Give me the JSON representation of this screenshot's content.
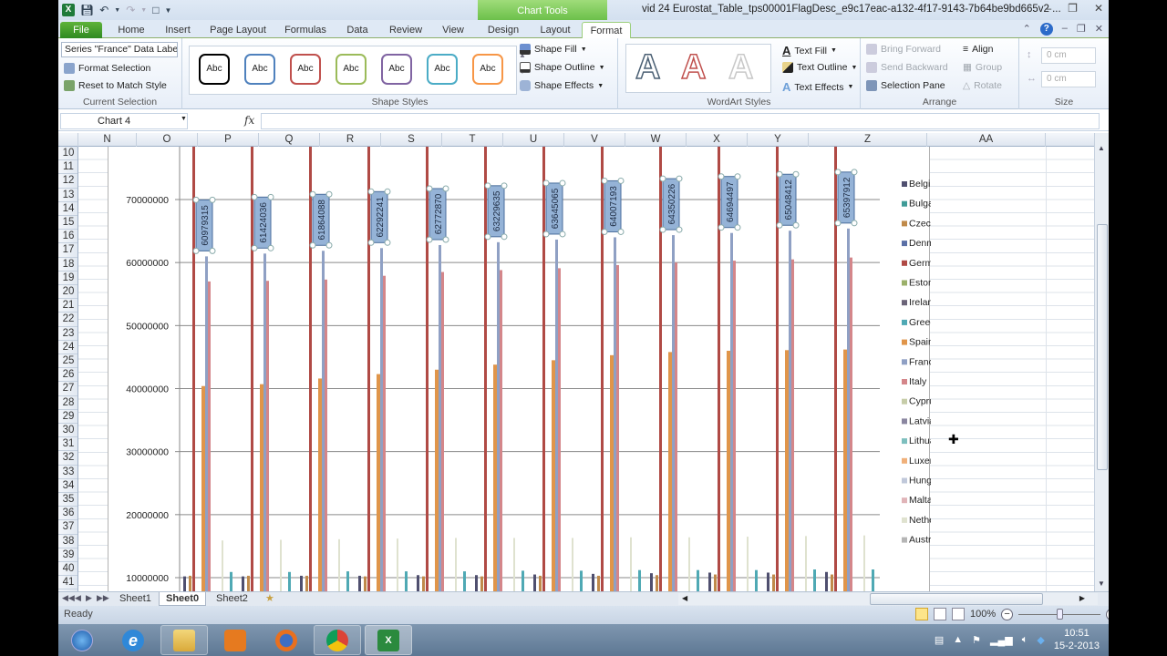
{
  "window": {
    "title": "vid 24 Eurostat_Table_tps00001FlagDesc_e9c17eac-a132-4f17-9143-7b64be9bd665v2 ...",
    "context_tab_group": "Chart Tools",
    "controls": [
      "minimize",
      "restore",
      "close"
    ]
  },
  "ribbon_tabs": [
    "File",
    "Home",
    "Insert",
    "Page Layout",
    "Formulas",
    "Data",
    "Review",
    "View",
    "Design",
    "Layout",
    "Format"
  ],
  "active_tab": "Format",
  "ribbon": {
    "current_selection": {
      "selector_value": "Series \"France\" Data Labe",
      "format_selection": "Format Selection",
      "reset_to_match_style": "Reset to Match Style",
      "label": "Current Selection"
    },
    "shape_styles": {
      "gallery": [
        {
          "text": "Abc",
          "color": "#000000"
        },
        {
          "text": "Abc",
          "color": "#4f81bd"
        },
        {
          "text": "Abc",
          "color": "#c0504d"
        },
        {
          "text": "Abc",
          "color": "#9bbb59"
        },
        {
          "text": "Abc",
          "color": "#8064a2"
        },
        {
          "text": "Abc",
          "color": "#4bacc6"
        },
        {
          "text": "Abc",
          "color": "#f79646"
        }
      ],
      "shape_fill": "Shape Fill",
      "shape_outline": "Shape Outline",
      "shape_effects": "Shape Effects",
      "label": "Shape Styles"
    },
    "wordart_styles": {
      "gallery": [
        {
          "text": "A",
          "color": "#4a5f73"
        },
        {
          "text": "A",
          "color": "#c0504d"
        },
        {
          "text": "A",
          "color": "#c8c8c8"
        }
      ],
      "text_fill": "Text Fill",
      "text_outline": "Text Outline",
      "text_effects": "Text Effects",
      "label": "WordArt Styles"
    },
    "arrange": {
      "bring_forward": "Bring Forward",
      "send_backward": "Send Backward",
      "selection_pane": "Selection Pane",
      "align": "Align",
      "group": "Group",
      "rotate": "Rotate",
      "label": "Arrange"
    },
    "size": {
      "height_value": "0 cm",
      "width_value": "0 cm",
      "label": "Size"
    }
  },
  "formula_bar": {
    "name_box": "Chart 4",
    "fx": "fx",
    "formula": ""
  },
  "columns": [
    "N",
    "O",
    "P",
    "Q",
    "R",
    "S",
    "T",
    "U",
    "V",
    "W",
    "X",
    "Y",
    "Z",
    "AA"
  ],
  "rows": [
    "10",
    "11",
    "12",
    "13",
    "14",
    "15",
    "16",
    "17",
    "18",
    "19",
    "20",
    "21",
    "22",
    "23",
    "24",
    "25",
    "26",
    "27",
    "28",
    "29",
    "30",
    "31",
    "32",
    "33",
    "34",
    "35",
    "36",
    "37",
    "38",
    "39",
    "40",
    "41"
  ],
  "chart_data": {
    "type": "bar",
    "title": "",
    "xlabel": "",
    "ylabel": "",
    "ylim": [
      10000000,
      70000000
    ],
    "y_ticks": [
      "10000000",
      "20000000",
      "30000000",
      "40000000",
      "50000000",
      "60000000",
      "70000000"
    ],
    "grid": true,
    "legend_position": "right",
    "groups_visible": 12,
    "selected_series": "France",
    "legend": [
      {
        "name": "Belgium",
        "color": "#4f4f6f"
      },
      {
        "name": "Bulgaria",
        "color": "#3f9b97"
      },
      {
        "name": "Czech Republic",
        "color": "#c08a4a"
      },
      {
        "name": "Denmark",
        "color": "#5a6fa6"
      },
      {
        "name": "Germany",
        "color": "#b04a45"
      },
      {
        "name": "Estonia",
        "color": "#9bb06a"
      },
      {
        "name": "Ireland",
        "color": "#6b6478"
      },
      {
        "name": "Greece",
        "color": "#4fa9b4"
      },
      {
        "name": "Spain",
        "color": "#e0954a"
      },
      {
        "name": "France",
        "color": "#8fa0c4"
      },
      {
        "name": "Italy",
        "color": "#d4868a"
      },
      {
        "name": "Cyprus",
        "color": "#c6cca8"
      },
      {
        "name": "Latvia",
        "color": "#8a86a0"
      },
      {
        "name": "Lithuania",
        "color": "#7dbfbe"
      },
      {
        "name": "Luxembourg",
        "color": "#f0b07a"
      },
      {
        "name": "Hungary",
        "color": "#c0c8da"
      },
      {
        "name": "Malta",
        "color": "#e0b4b8"
      },
      {
        "name": "Netherlands",
        "color": "#dfe2cf"
      },
      {
        "name": "Austria",
        "color": "#b5b5b5"
      }
    ],
    "series": [
      {
        "name": "France",
        "values": [
          60979315,
          61424036,
          61864088,
          62292241,
          62772870,
          63229635,
          63645065,
          64007193,
          64350226,
          64694497,
          65048412,
          65397912
        ],
        "data_labels": true
      },
      {
        "name": "Italy",
        "values": [
          57000000,
          57100000,
          57300000,
          57900000,
          58500000,
          58800000,
          59100000,
          59600000,
          60000000,
          60300000,
          60500000,
          60800000
        ]
      },
      {
        "name": "Spain",
        "values": [
          40400000,
          40700000,
          41600000,
          42300000,
          43000000,
          43800000,
          44500000,
          45300000,
          45800000,
          46000000,
          46100000,
          46200000
        ]
      },
      {
        "name": "Germany",
        "values": [
          82200000,
          82200000,
          82400000,
          82500000,
          82500000,
          82500000,
          82400000,
          82300000,
          82200000,
          81800000,
          81800000,
          81800000
        ]
      },
      {
        "name": "Netherlands",
        "values": [
          15900000,
          16000000,
          16100000,
          16200000,
          16300000,
          16300000,
          16300000,
          16400000,
          16400000,
          16500000,
          16600000,
          16700000
        ]
      },
      {
        "name": "Greece",
        "values": [
          10900000,
          10900000,
          11000000,
          11000000,
          11000000,
          11100000,
          11100000,
          11200000,
          11200000,
          11200000,
          11300000,
          11300000
        ]
      },
      {
        "name": "Belgium",
        "values": [
          10200000,
          10200000,
          10300000,
          10300000,
          10400000,
          10400000,
          10500000,
          10600000,
          10700000,
          10800000,
          10800000,
          10900000
        ]
      },
      {
        "name": "Czech Republic",
        "values": [
          10300000,
          10300000,
          10300000,
          10200000,
          10200000,
          10200000,
          10300000,
          10300000,
          10400000,
          10500000,
          10500000,
          10500000
        ]
      }
    ]
  },
  "sheet_tabs": [
    "Sheet1",
    "Sheet0",
    "Sheet2"
  ],
  "active_sheet": "Sheet0",
  "status": {
    "ready": "Ready",
    "zoom": "100%",
    "zoom_fraction": 0.5
  },
  "taskbar": {
    "apps": [
      "start",
      "internet-explorer",
      "file-explorer",
      "media-player",
      "firefox",
      "chrome",
      "excel"
    ],
    "clock_time": "10:51",
    "clock_date": "15-2-2013"
  }
}
